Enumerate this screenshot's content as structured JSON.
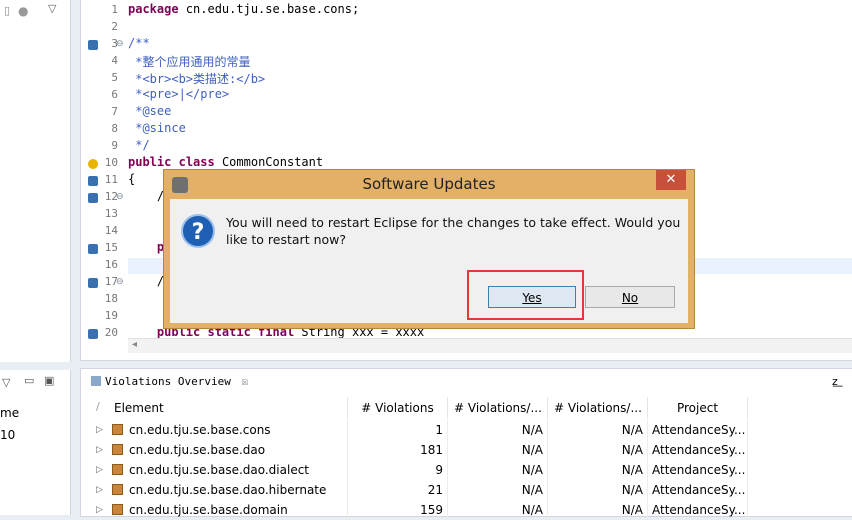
{
  "left": {
    "col_header": "me",
    "row_value": "10"
  },
  "editor": {
    "lines": [
      {
        "n": "1",
        "text": "package cn.edu.tju.se.base.cons;"
      },
      {
        "n": "2",
        "text": ""
      },
      {
        "n": "3",
        "text": "/**"
      },
      {
        "n": "4",
        "text": " *整个应用通用的常量"
      },
      {
        "n": "5",
        "text": " *<br><b>类描述:</b>"
      },
      {
        "n": "6",
        "text": " *<pre>|</pre>"
      },
      {
        "n": "7",
        "text": " *@see"
      },
      {
        "n": "8",
        "text": " *@since"
      },
      {
        "n": "9",
        "text": " */"
      },
      {
        "n": "10",
        "text": "public class CommonConstant"
      },
      {
        "n": "11",
        "text": "{"
      },
      {
        "n": "12",
        "text": "    /"
      },
      {
        "n": "13",
        "text": "     "
      },
      {
        "n": "14",
        "text": "     "
      },
      {
        "n": "15",
        "text": "    pu"
      },
      {
        "n": "16",
        "text": ""
      },
      {
        "n": "17",
        "text": "    /"
      },
      {
        "n": "18",
        "text": "     "
      },
      {
        "n": "19",
        "text": "     "
      },
      {
        "n": "20",
        "text": "    public static final String xxx = xxxx"
      }
    ]
  },
  "dialog": {
    "title": "Software Updates",
    "close": "✕",
    "message": "You will need to restart Eclipse for the changes to take effect. Would you like to restart now?",
    "yes": "Yes",
    "no": "No"
  },
  "panel": {
    "tab_label": "Violations Overview",
    "tab_close": "☒",
    "columns": [
      "Element",
      "# Violations",
      "# Violations/...",
      "# Violations/...",
      "Project"
    ],
    "rows": [
      {
        "element": "cn.edu.tju.se.base.cons",
        "violations": "1",
        "v2": "N/A",
        "v3": "N/A",
        "project": "AttendanceSy..."
      },
      {
        "element": "cn.edu.tju.se.base.dao",
        "violations": "181",
        "v2": "N/A",
        "v3": "N/A",
        "project": "AttendanceSy..."
      },
      {
        "element": "cn.edu.tju.se.base.dao.dialect",
        "violations": "9",
        "v2": "N/A",
        "v3": "N/A",
        "project": "AttendanceSy..."
      },
      {
        "element": "cn.edu.tju.se.base.dao.hibernate",
        "violations": "21",
        "v2": "N/A",
        "v3": "N/A",
        "project": "AttendanceSy..."
      },
      {
        "element": "cn.edu.tju.se.base.domain",
        "violations": "159",
        "v2": "N/A",
        "v3": "N/A",
        "project": "AttendanceSy..."
      }
    ]
  }
}
